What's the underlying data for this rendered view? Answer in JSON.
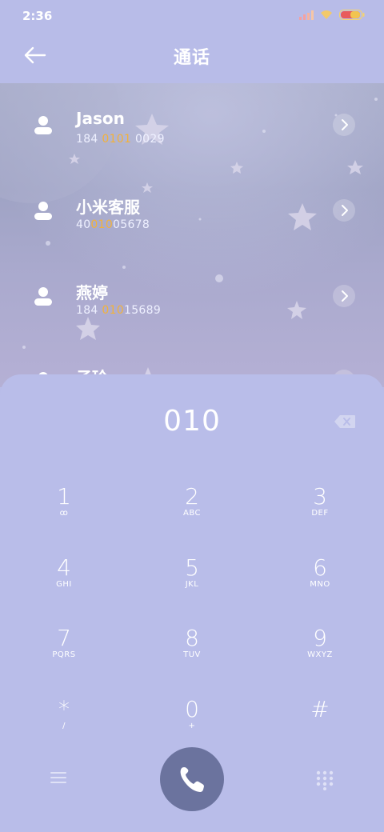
{
  "status": {
    "time": "2:36"
  },
  "header": {
    "title": "通话"
  },
  "contacts": [
    {
      "name": "Jason",
      "num_pre": "184 ",
      "num_hl": "0101",
      "num_post": " 0029"
    },
    {
      "name": "小米客服",
      "num_pre": "40",
      "num_hl": "010",
      "num_post": "05678"
    },
    {
      "name": "燕婷",
      "num_pre": "184 ",
      "num_hl": "010",
      "num_post": "15689"
    },
    {
      "name": "子玲",
      "num_pre": "",
      "num_hl": "",
      "num_post": ""
    }
  ],
  "dialer": {
    "input": "010",
    "keys": [
      {
        "digit": "1",
        "letters": "ꝏ"
      },
      {
        "digit": "2",
        "letters": "ABC"
      },
      {
        "digit": "3",
        "letters": "DEF"
      },
      {
        "digit": "4",
        "letters": "GHI"
      },
      {
        "digit": "5",
        "letters": "JKL"
      },
      {
        "digit": "6",
        "letters": "MNO"
      },
      {
        "digit": "7",
        "letters": "PQRS"
      },
      {
        "digit": "8",
        "letters": "TUV"
      },
      {
        "digit": "9",
        "letters": "WXYZ"
      },
      {
        "digit": "*",
        "letters": "/"
      },
      {
        "digit": "0",
        "letters": "+"
      },
      {
        "digit": "#",
        "letters": ""
      }
    ]
  },
  "colors": {
    "accent": "#f3b23a",
    "background": "#b9bde9",
    "call_button": "#6b739e"
  },
  "icons": {
    "back": "arrow-left-icon",
    "avatar": "person-icon",
    "chevron": "chevron-right-icon",
    "backspace": "backspace-icon",
    "menu": "menu-icon",
    "call": "phone-icon",
    "grid": "dialpad-icon"
  }
}
